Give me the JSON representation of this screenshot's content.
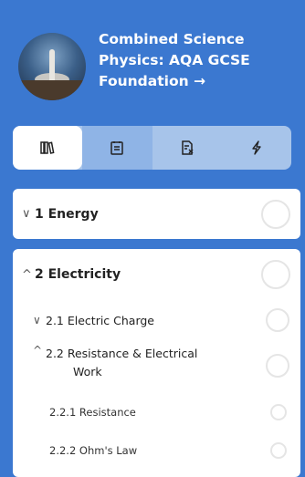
{
  "course": {
    "title_line1": "Combined Science",
    "title_line2": "Physics: AQA GCSE",
    "title_line3": "Foundation →",
    "avatar_icon": "rocket-launch-thumbnail"
  },
  "tabs": [
    {
      "icon": "books-icon",
      "active": true
    },
    {
      "icon": "clipboard-icon",
      "active": false
    },
    {
      "icon": "test-paper-icon",
      "active": false
    },
    {
      "icon": "lightning-icon",
      "active": false
    }
  ],
  "sections": [
    {
      "chevron": "∨",
      "label": "1 Energy"
    },
    {
      "chevron": "^",
      "label": "2 Electricity"
    }
  ],
  "subsections": [
    {
      "chevron": "∨",
      "label": "2.1 Electric Charge"
    },
    {
      "chevron": "^",
      "label_line1": "2.2 Resistance & Electrical",
      "label_line2": "Work"
    }
  ],
  "topics": [
    {
      "label": "2.2.1 Resistance"
    },
    {
      "label": "2.2.2 Ohm's Law"
    }
  ]
}
